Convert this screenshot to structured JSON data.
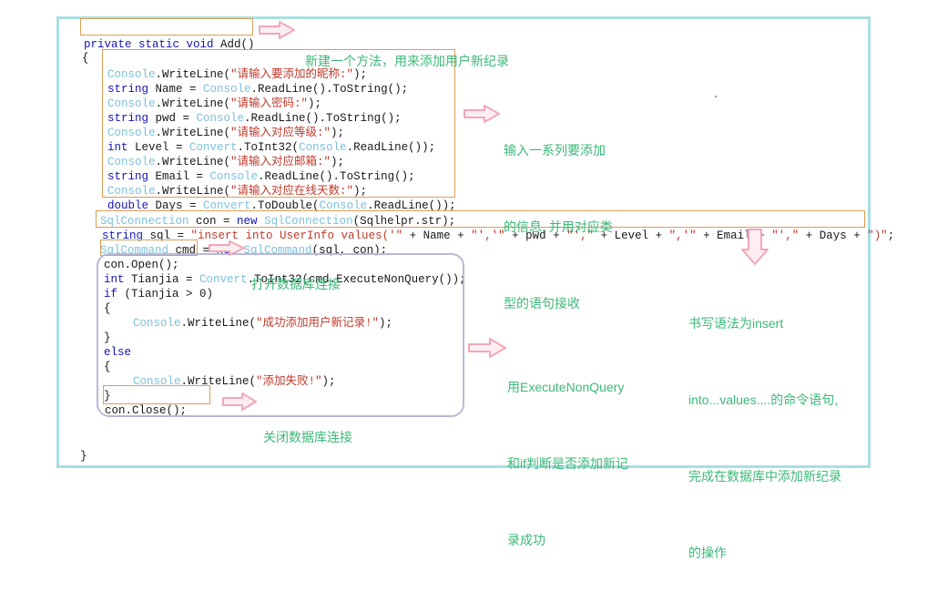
{
  "document": {
    "frame_border_color": "#a8dfe4",
    "background_color": "#ffffff"
  },
  "code": {
    "language": "csharp",
    "lines": [
      {
        "id": "l1",
        "text": "private static void Add()"
      },
      {
        "id": "l2",
        "text": "{"
      },
      {
        "id": "l3",
        "text": "Console.WriteLine(\"请输入要添加的昵称:\");"
      },
      {
        "id": "l4",
        "text": "string Name = Console.ReadLine().ToString();"
      },
      {
        "id": "l5",
        "text": "Console.WriteLine(\"请输入密码:\");"
      },
      {
        "id": "l6",
        "text": "string pwd = Console.ReadLine().ToString();"
      },
      {
        "id": "l7",
        "text": "Console.WriteLine(\"请输入对应等级:\");"
      },
      {
        "id": "l8",
        "text": "int Level = Convert.ToInt32(Console.ReadLine());"
      },
      {
        "id": "l9",
        "text": "Console.WriteLine(\"请输入对应邮箱:\");"
      },
      {
        "id": "l10",
        "text": "string Email = Console.ReadLine().ToString();"
      },
      {
        "id": "l11",
        "text": "Console.WriteLine(\"请输入对应在线天数:\");"
      },
      {
        "id": "l12",
        "text": "double Days = Convert.ToDouble(Console.ReadLine());"
      },
      {
        "id": "l13",
        "text": "SqlConnection con = new SqlConnection(Sqlhelpr.str);"
      },
      {
        "id": "l14",
        "text": "string sql = \"insert into UserInfo values('\" + Name + \"','\" + pwd + \"',\" + Level + \",'\" + Email + \"',\" + Days + \")\";"
      },
      {
        "id": "l15",
        "text": "SqlCommand cmd = new SqlCommand(sql, con);"
      },
      {
        "id": "l16",
        "text": "con.Open();"
      },
      {
        "id": "l17",
        "text": "int Tianjia = Convert.ToInt32(cmd.ExecuteNonQuery());"
      },
      {
        "id": "l18",
        "text": "if (Tianjia > 0)"
      },
      {
        "id": "l19",
        "text": "{"
      },
      {
        "id": "l20",
        "text": "Console.WriteLine(\"成功添加用户新记录!\");"
      },
      {
        "id": "l21",
        "text": "}"
      },
      {
        "id": "l22",
        "text": "else"
      },
      {
        "id": "l23",
        "text": "{"
      },
      {
        "id": "l24",
        "text": "Console.WriteLine(\"添加失败!\");"
      },
      {
        "id": "l25",
        "text": "}"
      },
      {
        "id": "l26",
        "text": "con.Close();"
      },
      {
        "id": "l27",
        "text": "}"
      }
    ],
    "tokens": {
      "l1": [
        [
          "kw",
          "private static void "
        ],
        [
          "plain",
          "Add()"
        ]
      ],
      "l2": [
        [
          "plain",
          "{"
        ]
      ],
      "l3": [
        [
          "typ",
          "Console"
        ],
        [
          "plain",
          ".WriteLine("
        ],
        [
          "str",
          "\"请输入要添加的昵称:\""
        ],
        [
          "plain",
          ");"
        ]
      ],
      "l4": [
        [
          "kw",
          "string "
        ],
        [
          "plain",
          "Name = "
        ],
        [
          "typ",
          "Console"
        ],
        [
          "plain",
          ".ReadLine().ToString();"
        ]
      ],
      "l5": [
        [
          "typ",
          "Console"
        ],
        [
          "plain",
          ".WriteLine("
        ],
        [
          "str",
          "\"请输入密码:\""
        ],
        [
          "plain",
          ");"
        ]
      ],
      "l6": [
        [
          "kw",
          "string "
        ],
        [
          "plain",
          "pwd = "
        ],
        [
          "typ",
          "Console"
        ],
        [
          "plain",
          ".ReadLine().ToString();"
        ]
      ],
      "l7": [
        [
          "typ",
          "Console"
        ],
        [
          "plain",
          ".WriteLine("
        ],
        [
          "str",
          "\"请输入对应等级:\""
        ],
        [
          "plain",
          ");"
        ]
      ],
      "l8": [
        [
          "kw",
          "int "
        ],
        [
          "plain",
          "Level = "
        ],
        [
          "typ",
          "Convert"
        ],
        [
          "plain",
          ".ToInt32("
        ],
        [
          "typ",
          "Console"
        ],
        [
          "plain",
          ".ReadLine());"
        ]
      ],
      "l9": [
        [
          "typ",
          "Console"
        ],
        [
          "plain",
          ".WriteLine("
        ],
        [
          "str",
          "\"请输入对应邮箱:\""
        ],
        [
          "plain",
          ");"
        ]
      ],
      "l10": [
        [
          "kw",
          "string "
        ],
        [
          "plain",
          "Email = "
        ],
        [
          "typ",
          "Console"
        ],
        [
          "plain",
          ".ReadLine().ToString();"
        ]
      ],
      "l11": [
        [
          "typ",
          "Console"
        ],
        [
          "plain",
          ".WriteLine("
        ],
        [
          "str",
          "\"请输入对应在线天数:\""
        ],
        [
          "plain",
          ");"
        ]
      ],
      "l12": [
        [
          "kw",
          "double "
        ],
        [
          "plain",
          "Days = "
        ],
        [
          "typ",
          "Convert"
        ],
        [
          "plain",
          ".ToDouble("
        ],
        [
          "typ",
          "Console"
        ],
        [
          "plain",
          ".ReadLine());"
        ]
      ],
      "l13": [
        [
          "typ",
          "SqlConnection"
        ],
        [
          "plain",
          " con = "
        ],
        [
          "kw",
          "new "
        ],
        [
          "typ",
          "SqlConnection"
        ],
        [
          "plain",
          "(Sqlhelpr.str);"
        ]
      ],
      "l14": [
        [
          "kw",
          "string "
        ],
        [
          "plain",
          "sql = "
        ],
        [
          "str",
          "\"insert into UserInfo values('\""
        ],
        [
          "plain",
          " + Name + "
        ],
        [
          "str",
          "\"','\""
        ],
        [
          "plain",
          " + pwd + "
        ],
        [
          "str",
          "\"',\""
        ],
        [
          "plain",
          " + Level + "
        ],
        [
          "str",
          "\",'\""
        ],
        [
          "plain",
          " + Email + "
        ],
        [
          "str",
          "\"',\""
        ],
        [
          "plain",
          " + Days + "
        ],
        [
          "str",
          "\")\""
        ],
        [
          "plain",
          ";"
        ]
      ],
      "l15": [
        [
          "typ",
          "SqlCommand"
        ],
        [
          "plain",
          " cmd = "
        ],
        [
          "kw",
          "new "
        ],
        [
          "typ",
          "SqlCommand"
        ],
        [
          "plain",
          "(sql, con);"
        ]
      ],
      "l16": [
        [
          "plain",
          "con.Open();"
        ]
      ],
      "l17": [
        [
          "kw",
          "int "
        ],
        [
          "plain",
          "Tianjia = "
        ],
        [
          "typ",
          "Convert"
        ],
        [
          "plain",
          ".ToInt32(cmd.ExecuteNonQuery());"
        ]
      ],
      "l18": [
        [
          "kw",
          "if "
        ],
        [
          "plain",
          "(Tianjia > 0)"
        ]
      ],
      "l19": [
        [
          "plain",
          "{"
        ]
      ],
      "l20": [
        [
          "typ",
          "Console"
        ],
        [
          "plain",
          ".WriteLine("
        ],
        [
          "str",
          "\"成功添加用户新记录!\""
        ],
        [
          "plain",
          ");"
        ]
      ],
      "l21": [
        [
          "plain",
          "}"
        ]
      ],
      "l22": [
        [
          "kw",
          "else"
        ]
      ],
      "l23": [
        [
          "plain",
          "{"
        ]
      ],
      "l24": [
        [
          "typ",
          "Console"
        ],
        [
          "plain",
          ".WriteLine("
        ],
        [
          "str",
          "\"添加失败!\""
        ],
        [
          "plain",
          ");"
        ]
      ],
      "l25": [
        [
          "plain",
          "}"
        ]
      ],
      "l26": [
        [
          "plain",
          "con.Close();"
        ]
      ],
      "l27": [
        [
          "plain",
          "}"
        ]
      ]
    }
  },
  "highlights": [
    {
      "id": "hl-method-signature",
      "name": "highlight-method-signature",
      "style": "orange-rect",
      "color": "#d8a055"
    },
    {
      "id": "hl-input-block",
      "name": "highlight-input-block",
      "style": "orange-rect",
      "color": "#d8a055"
    },
    {
      "id": "hl-sql-string",
      "name": "highlight-sql-string",
      "style": "orange-rect",
      "color": "#d8a055"
    },
    {
      "id": "hl-con-open",
      "name": "highlight-con-open",
      "style": "orange-rect",
      "color": "#d8a055"
    },
    {
      "id": "hl-con-close",
      "name": "highlight-con-close",
      "style": "orange-rect",
      "color": "#d8a055"
    },
    {
      "id": "hl-if-else-block",
      "name": "highlight-if-else-block",
      "style": "purple-rounded",
      "color": "#b9b9d8"
    }
  ],
  "annotations": {
    "arrow_color": "#f7c6cf",
    "text_color": "#3cb878",
    "items": [
      {
        "id": "ann-new-method",
        "arrow": "arrow-right-icon",
        "direction": "right",
        "lines": [
          "新建一个方法，用来添加用户新纪录"
        ]
      },
      {
        "id": "ann-input-series",
        "arrow": "arrow-right-icon",
        "direction": "right",
        "lines": [
          "输入一系列要添加",
          "的信息, 并用对应类",
          "型的语句接收"
        ]
      },
      {
        "id": "ann-open-db",
        "arrow": "arrow-right-icon",
        "direction": "right",
        "lines": [
          "打开数据库连接"
        ]
      },
      {
        "id": "ann-insert-syntax",
        "arrow": "arrow-down-icon",
        "direction": "down",
        "lines": [
          "书写语法为insert",
          "into...values....的命令语句,",
          "完成在数据库中添加新纪录",
          "的操作"
        ]
      },
      {
        "id": "ann-execute-nonquery",
        "arrow": "arrow-right-icon",
        "direction": "right",
        "lines": [
          "用ExecuteNonQuery",
          "和if判断是否添加新记",
          "录成功"
        ]
      },
      {
        "id": "ann-close-db",
        "arrow": "arrow-right-icon",
        "direction": "right",
        "lines": [
          "关闭数据库连接"
        ]
      }
    ]
  }
}
